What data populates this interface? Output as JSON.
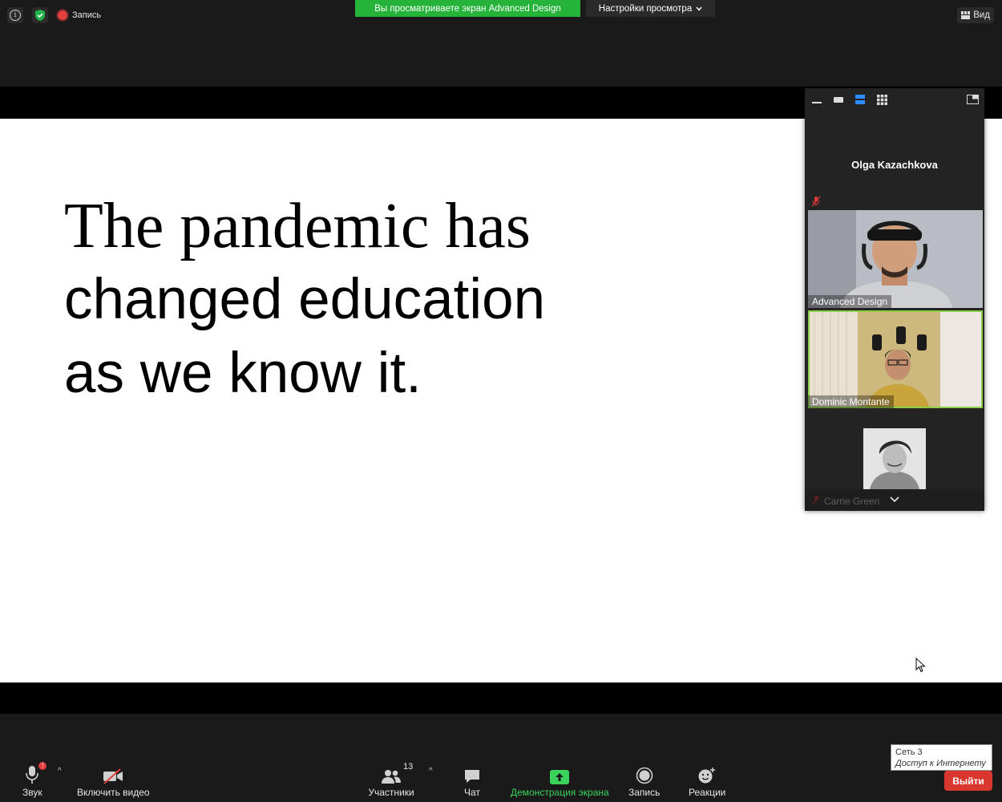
{
  "topbar": {
    "recording_label": "Запись",
    "share_banner": "Вы просматриваете экран Advanced Design",
    "view_options": "Настройки просмотра",
    "view_button": "Вид"
  },
  "slide": {
    "line1": "The pandemic has",
    "line2": "changed education",
    "line3": "as we know it."
  },
  "gallery": {
    "top_participant": "Olga Kazachkova",
    "tiles": [
      {
        "name": "Advanced Design"
      },
      {
        "name": "Dominic Montante"
      },
      {
        "name": "Carrie Green"
      }
    ]
  },
  "controls": {
    "audio": "Звук",
    "video": "Включить видео",
    "participants": "Участники",
    "participants_count": "13",
    "chat": "Чат",
    "share": "Демонстрация экрана",
    "record": "Запись",
    "reactions": "Реакции",
    "leave": "Выйти"
  },
  "tooltip": {
    "line1": "Сеть  3",
    "line2": "Доступ к Интернету"
  },
  "colors": {
    "share_green": "#25b33a",
    "leave_red": "#d9372e",
    "active_speaker": "#8ecf4a"
  }
}
